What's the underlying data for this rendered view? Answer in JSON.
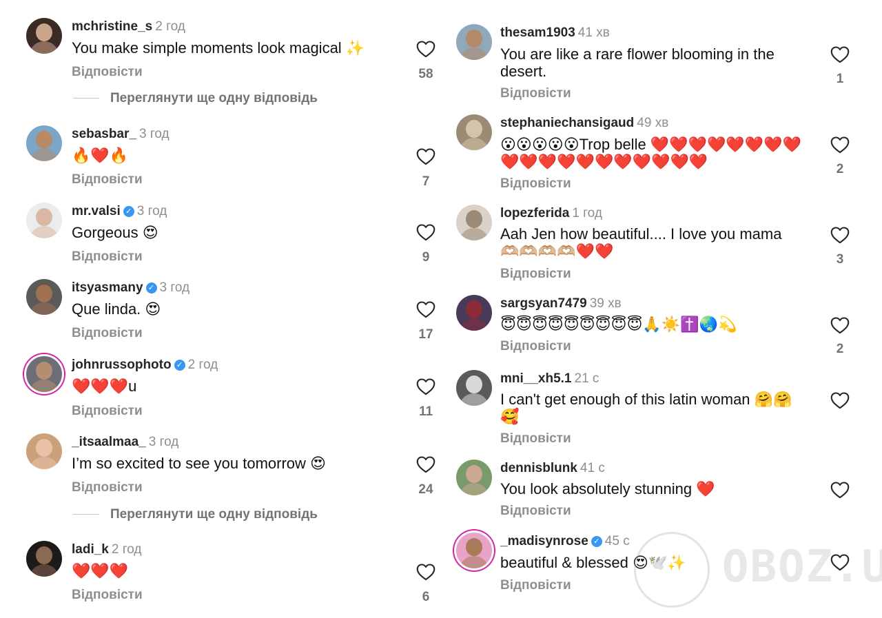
{
  "reply_label": "Відповісти",
  "view_more_label": "Переглянути ще одну відповідь",
  "left": [
    {
      "username": "mchristine_s",
      "time": "2 год",
      "verified": false,
      "text": "You make simple moments look magical ✨",
      "likes": "58",
      "view_more": true,
      "avatar_face": "#c9a48b",
      "avatar_bg": "#3b2a25"
    },
    {
      "username": "sebasbar_",
      "time": "3 год",
      "verified": false,
      "text": "🔥❤️🔥",
      "likes": "7",
      "view_more": false,
      "avatar_face": "#b98a68",
      "avatar_bg": "#7aa6c8"
    },
    {
      "username": "mr.valsi",
      "time": "3 год",
      "verified": true,
      "text": "Gorgeous 😍",
      "likes": "9",
      "view_more": false,
      "avatar_face": "#d9b9a3",
      "avatar_bg": "#ececec"
    },
    {
      "username": "itsyasmany",
      "time": "3 год",
      "verified": true,
      "text": "Que linda. 😍",
      "likes": "17",
      "view_more": false,
      "avatar_face": "#a07050",
      "avatar_bg": "#5a5a5a"
    },
    {
      "username": "johnrussophoto",
      "time": "2 год",
      "verified": true,
      "text": "❤️❤️❤️u",
      "likes": "11",
      "view_more": false,
      "ring": true,
      "avatar_face": "#b68d70",
      "avatar_bg": "#6c6f78"
    },
    {
      "username": "_itsaalmaa_",
      "time": "3 год",
      "verified": false,
      "text": "I’m so excited to see you tomorrow 😍",
      "likes": "24",
      "view_more": true,
      "avatar_face": "#e8c2a8",
      "avatar_bg": "#c9a27a"
    },
    {
      "username": "ladi_k",
      "time": "2 год",
      "verified": false,
      "text": "❤️❤️❤️",
      "likes": "6",
      "view_more": false,
      "avatar_face": "#8a6a55",
      "avatar_bg": "#1e1a18"
    }
  ],
  "right": [
    {
      "username": "thesam1903",
      "time": "41 хв",
      "verified": false,
      "text": "You are like a rare flower blooming in the desert.",
      "likes": "1",
      "avatar_face": "#b48a6a",
      "avatar_bg": "#8fa9b8"
    },
    {
      "username": "stephaniechansigaud",
      "time": "49 хв",
      "verified": false,
      "text": "😮😮😮😮😮Trop belle ❤️❤️❤️❤️❤️❤️❤️❤️❤️❤️❤️❤️❤️❤️❤️❤️❤️❤️❤️",
      "likes": "2",
      "avatar_face": "#d6c4a8",
      "avatar_bg": "#9c8b74"
    },
    {
      "username": "lopezferida",
      "time": "1 год",
      "verified": false,
      "text": "Aah Jen how beautiful.... I love you mama 🫶🏼🫶🏼🫶🏼🫶🏼❤️❤️",
      "likes": "3",
      "avatar_face": "#9a8a78",
      "avatar_bg": "#d8d2c8"
    },
    {
      "username": "sargsyan7479",
      "time": "39 хв",
      "verified": false,
      "text": "😇😇😇😇😇😇😇😇😇🙏☀️✝️🌏💫",
      "likes": "2",
      "avatar_face": "#8c2b3a",
      "avatar_bg": "#4a3a5a"
    },
    {
      "username": "mni__xh5.1",
      "time": "21 с",
      "verified": false,
      "text": "I can't get enough of this latin woman 🤗🤗🥰",
      "likes": "",
      "avatar_face": "#d8d8d8",
      "avatar_bg": "#5a5a5a"
    },
    {
      "username": "dennisblunk",
      "time": "41 с",
      "verified": false,
      "text": "You look absolutely stunning ❤️",
      "likes": "",
      "avatar_face": "#c9a88f",
      "avatar_bg": "#7a9a6a"
    },
    {
      "username": "_madisynrose",
      "time": "45 с",
      "verified": true,
      "text": "beautiful & blessed 😍🕊️✨",
      "likes": "",
      "ring": true,
      "avatar_face": "#a87a5a",
      "avatar_bg": "#e9a3c9"
    }
  ],
  "watermark": "OBOZ.UA",
  "colors": {
    "text": "#111111",
    "muted": "#8e8e8e",
    "verified": "#3897f0",
    "story_ring": "#d6249f"
  }
}
